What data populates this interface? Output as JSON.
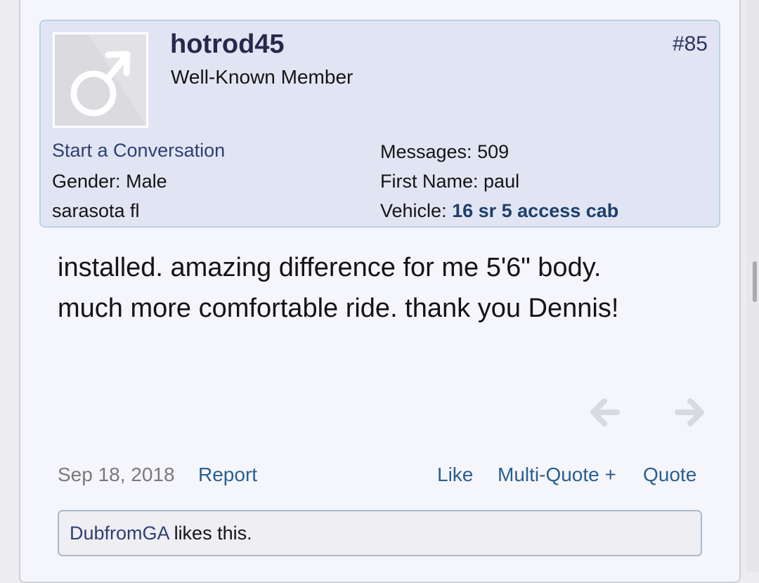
{
  "post": {
    "username": "hotrod45",
    "user_title": "Well-Known Member",
    "post_number": "#85",
    "avatar_icon": "male-symbol-icon",
    "start_conversation": "Start a Conversation",
    "gender_label": "Gender:",
    "gender_value": "Male",
    "location": "sarasota fl",
    "messages_label": "Messages:",
    "messages_value": "509",
    "first_name_label": "First Name:",
    "first_name_value": "paul",
    "vehicle_label": "Vehicle:",
    "vehicle_value": "16 sr 5 access cab",
    "body_line_1": "installed. amazing difference for me 5'6\" body.",
    "body_line_2": "much more comfortable ride. thank you Dennis!",
    "date": "Sep 18, 2018",
    "report": "Report",
    "like": "Like",
    "multi_quote": "Multi-Quote +",
    "quote": "Quote",
    "liker": "DubfromGA",
    "likes_suffix": " likes this."
  },
  "icons": {
    "prev": "arrow-left-icon",
    "next": "arrow-right-icon"
  },
  "colors": {
    "card_background": "#e1e5f3",
    "card_border": "#b8d3e3",
    "link": "#2a5f8e",
    "username": "#252a4c",
    "vehicle": "#1d3f6d"
  }
}
